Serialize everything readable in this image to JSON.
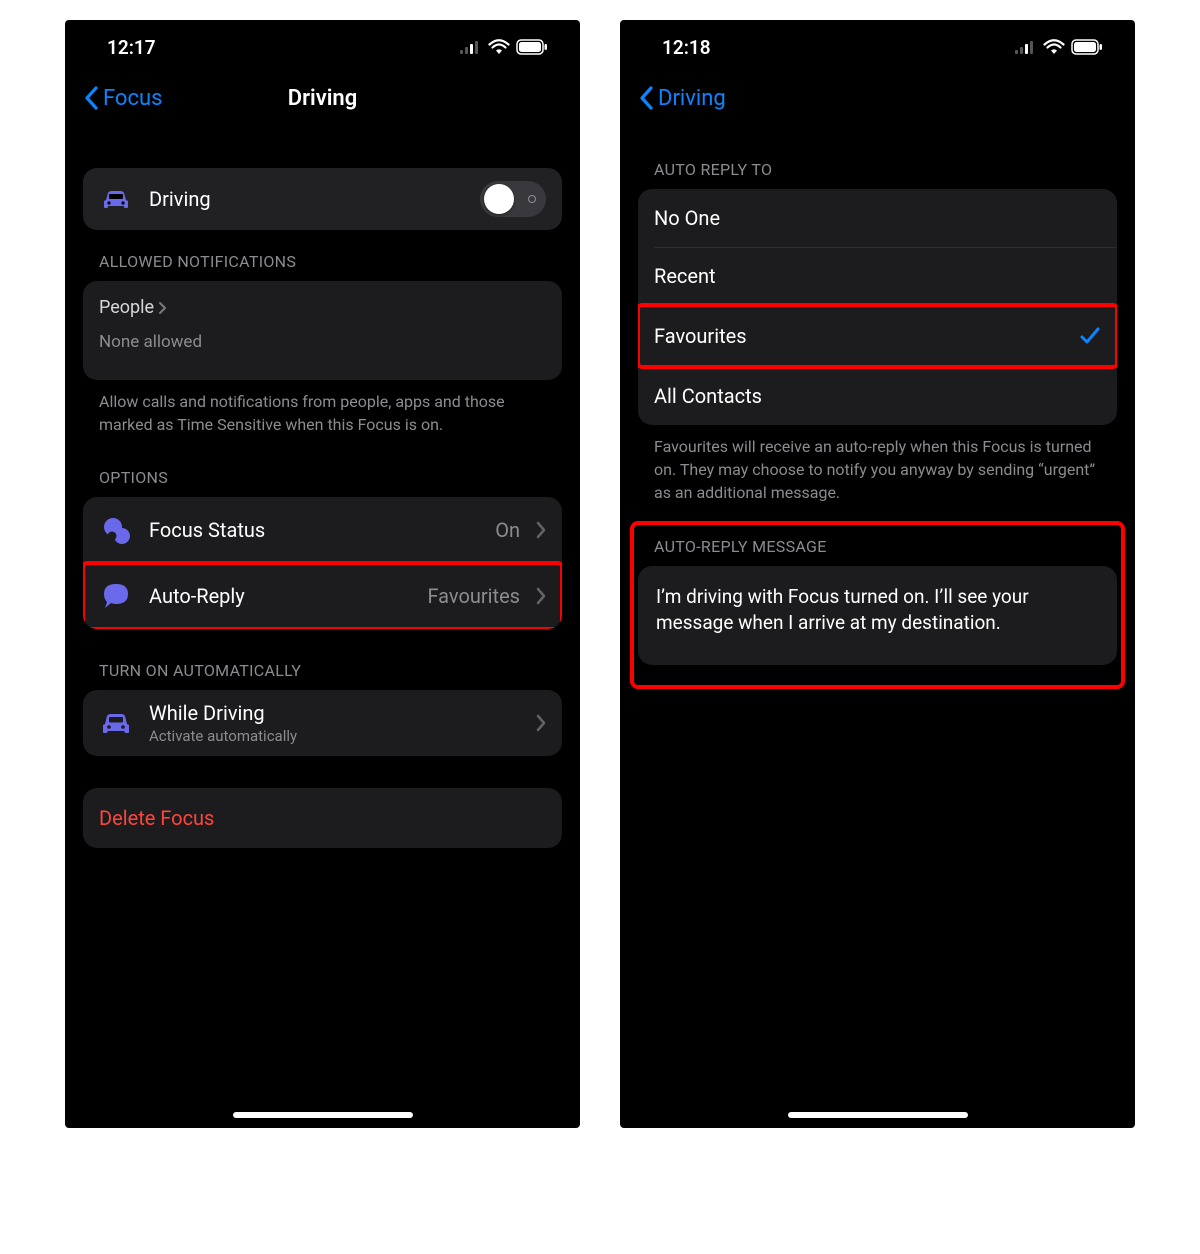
{
  "left": {
    "status_time": "12:17",
    "nav_back": "Focus",
    "nav_title": "Driving",
    "toggle_label": "Driving",
    "sections": {
      "allowed_header": "ALLOWED NOTIFICATIONS",
      "people_label": "People",
      "people_value": "None allowed",
      "allowed_footer": "Allow calls and notifications from people, apps and those marked as Time Sensitive when this Focus is on.",
      "options_header": "OPTIONS",
      "focus_status_label": "Focus Status",
      "focus_status_value": "On",
      "auto_reply_label": "Auto-Reply",
      "auto_reply_value": "Favourites",
      "auto_header": "TURN ON AUTOMATICALLY",
      "while_driving_label": "While Driving",
      "while_driving_sub": "Activate automatically",
      "delete_label": "Delete Focus"
    }
  },
  "right": {
    "status_time": "12:18",
    "nav_back": "Driving",
    "sections": {
      "replyto_header": "AUTO REPLY TO",
      "options": [
        "No One",
        "Recent",
        "Favourites",
        "All Contacts"
      ],
      "selected_index": 2,
      "replyto_footer": "Favourites will receive an auto-reply when this Focus is turned on. They may choose to notify you anyway by sending “urgent” as an additional message.",
      "msg_header": "AUTO-REPLY MESSAGE",
      "msg_body": "I’m driving with Focus turned on. I’ll see your message when I arrive at my destination."
    }
  }
}
